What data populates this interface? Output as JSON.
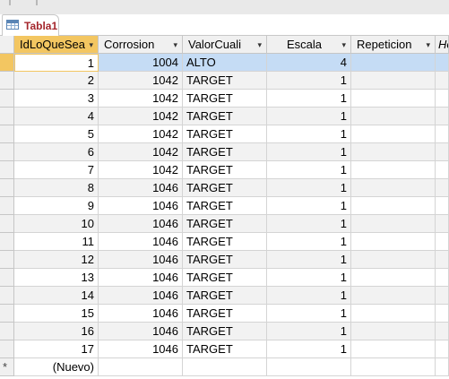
{
  "tab": {
    "label": "Tabla1",
    "icon": "table-icon"
  },
  "columns": [
    {
      "label": "IdLoQueSea",
      "sort": "▾"
    },
    {
      "label": "Corrosion",
      "sort": "▾"
    },
    {
      "label": "ValorCuali",
      "sort": "▾"
    },
    {
      "label": "Escala",
      "sort": "▾"
    },
    {
      "label": "Repeticion",
      "sort": "▾"
    },
    {
      "label": "Ho"
    }
  ],
  "rows": [
    {
      "id": "1",
      "corrosion": "1004",
      "valor": "ALTO",
      "escala": "4"
    },
    {
      "id": "2",
      "corrosion": "1042",
      "valor": "TARGET",
      "escala": "1"
    },
    {
      "id": "3",
      "corrosion": "1042",
      "valor": "TARGET",
      "escala": "1"
    },
    {
      "id": "4",
      "corrosion": "1042",
      "valor": "TARGET",
      "escala": "1"
    },
    {
      "id": "5",
      "corrosion": "1042",
      "valor": "TARGET",
      "escala": "1"
    },
    {
      "id": "6",
      "corrosion": "1042",
      "valor": "TARGET",
      "escala": "1"
    },
    {
      "id": "7",
      "corrosion": "1042",
      "valor": "TARGET",
      "escala": "1"
    },
    {
      "id": "8",
      "corrosion": "1046",
      "valor": "TARGET",
      "escala": "1"
    },
    {
      "id": "9",
      "corrosion": "1046",
      "valor": "TARGET",
      "escala": "1"
    },
    {
      "id": "10",
      "corrosion": "1046",
      "valor": "TARGET",
      "escala": "1"
    },
    {
      "id": "11",
      "corrosion": "1046",
      "valor": "TARGET",
      "escala": "1"
    },
    {
      "id": "12",
      "corrosion": "1046",
      "valor": "TARGET",
      "escala": "1"
    },
    {
      "id": "13",
      "corrosion": "1046",
      "valor": "TARGET",
      "escala": "1"
    },
    {
      "id": "14",
      "corrosion": "1046",
      "valor": "TARGET",
      "escala": "1"
    },
    {
      "id": "15",
      "corrosion": "1046",
      "valor": "TARGET",
      "escala": "1"
    },
    {
      "id": "16",
      "corrosion": "1046",
      "valor": "TARGET",
      "escala": "1"
    },
    {
      "id": "17",
      "corrosion": "1046",
      "valor": "TARGET",
      "escala": "1"
    }
  ],
  "new_row": {
    "marker": "*",
    "label": "(Nuevo)"
  },
  "colors": {
    "header_active": "#f3c661",
    "selection": "#c5dcf5",
    "tab_text": "#a4262c"
  }
}
